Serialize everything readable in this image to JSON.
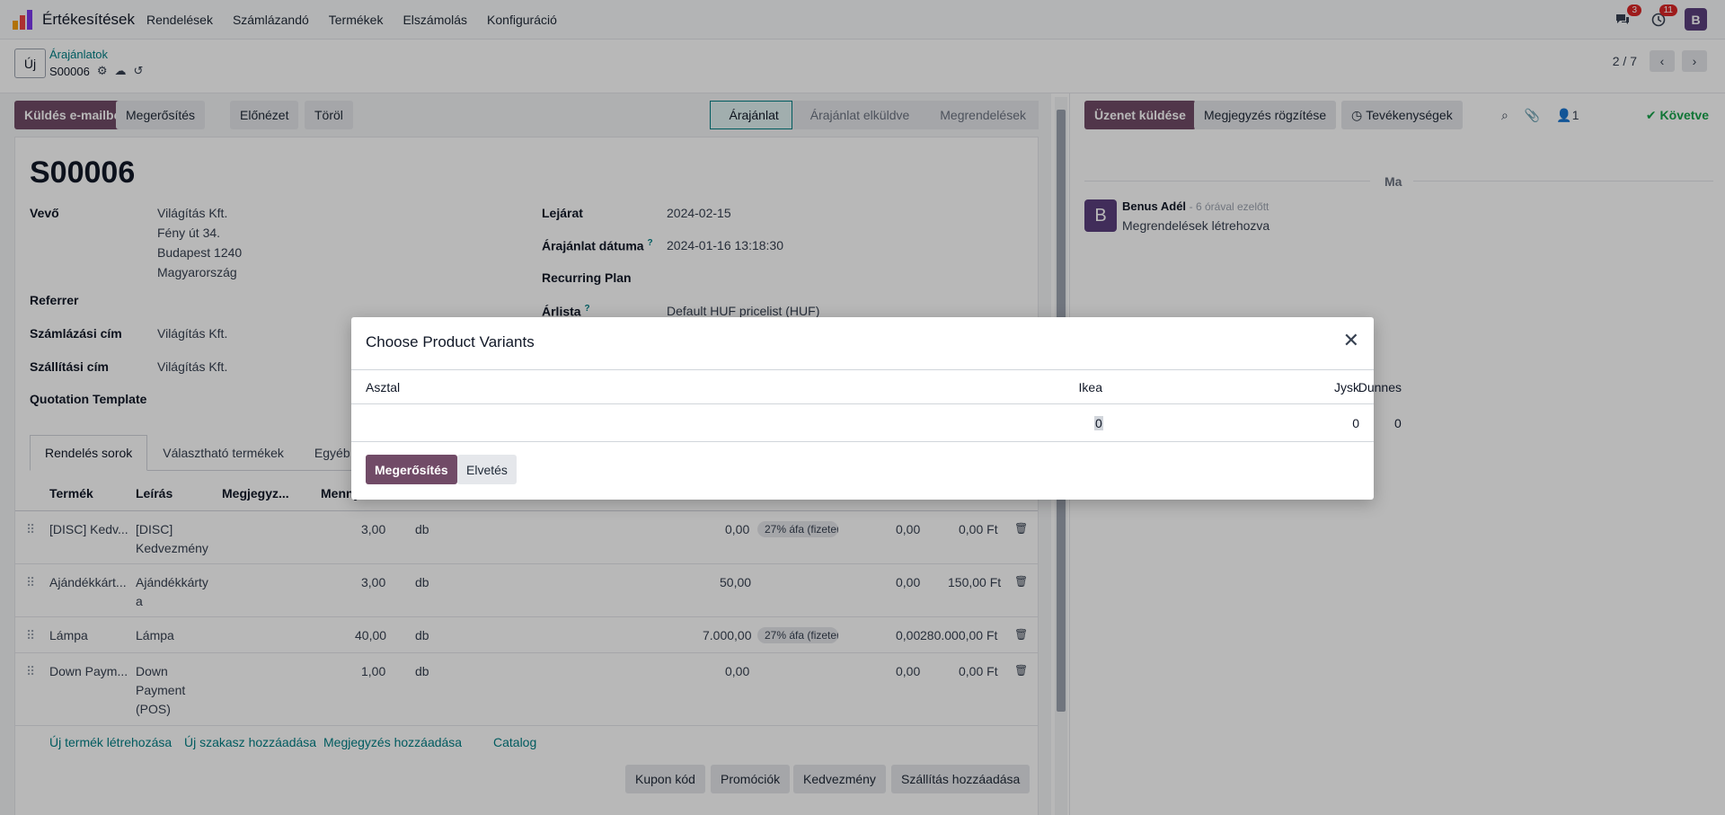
{
  "navbar": {
    "app_name": "Értékesítések",
    "menu": [
      "Rendelések",
      "Számlázandó",
      "Termékek",
      "Elszámolás",
      "Konfiguráció"
    ],
    "messages_badge": "3",
    "activities_badge": "11",
    "user_initial": "B"
  },
  "control": {
    "new_label": "Új",
    "breadcrumb": "Árajánlatok",
    "record": "S00006",
    "pager": "2 / 7"
  },
  "statusbar": {
    "buttons": [
      "Küldés e-mailben",
      "Megerősítés",
      "Előnézet",
      "Töröl"
    ],
    "stages": [
      "Árajánlat",
      "Árajánlat elküldve",
      "Megrendelések"
    ]
  },
  "form": {
    "title": "S00006",
    "customer_label": "Vevő",
    "customer_lines": [
      "Világítás Kft.",
      "Fény út 34.",
      "Budapest 1240",
      "Magyarország"
    ],
    "referrer_label": "Referrer",
    "invoice_address_label": "Számlázási cím",
    "invoice_address": "Világítás Kft.",
    "delivery_address_label": "Szállítási cím",
    "delivery_address": "Világítás Kft.",
    "template_label": "Quotation Template",
    "expiration_label": "Lejárat",
    "expiration": "2024-02-15",
    "quote_date_label": "Árajánlat dátuma",
    "quote_date": "2024-01-16 13:18:30",
    "recurring_label": "Recurring Plan",
    "pricelist_label": "Árlista",
    "pricelist": "Default HUF pricelist (HUF)",
    "tooltip_mark": "?"
  },
  "tabs": [
    "Rendelés sorok",
    "Választható termékek",
    "Egyéb információ"
  ],
  "table": {
    "headers": [
      "Termék",
      "Leírás",
      "Megjegyz...",
      "Menny"
    ],
    "rows": [
      {
        "product": "[DISC] Kedv...",
        "desc1": "[DISC]",
        "desc2": "Kedvezmény",
        "desc3": "",
        "qty": "3,00",
        "uom": "db",
        "price": "0,00",
        "tax": "27% áfa (fizetendő)",
        "disc": "0,00",
        "subtotal": "0,00 Ft"
      },
      {
        "product": "Ajándékkárt...",
        "desc1": "Ajándékkárty",
        "desc2": "a",
        "desc3": "",
        "qty": "3,00",
        "uom": "db",
        "price": "50,00",
        "tax": "",
        "disc": "0,00",
        "subtotal": "150,00 Ft"
      },
      {
        "product": "Lámpa",
        "desc1": "Lámpa",
        "desc2": "",
        "desc3": "",
        "qty": "40,00",
        "uom": "db",
        "price": "7.000,00",
        "tax": "27% áfa (fizetendő)",
        "disc": "0,00",
        "subtotal": "280.000,00 Ft"
      },
      {
        "product": "Down Paym...",
        "desc1": "Down",
        "desc2": "Payment",
        "desc3": "(POS)",
        "qty": "1,00",
        "uom": "db",
        "price": "0,00",
        "tax": "",
        "disc": "0,00",
        "subtotal": "0,00 Ft"
      }
    ]
  },
  "links": [
    "Új termék létrehozása",
    "Új szakasz hozzáadása",
    "Megjegyzés hozzáadása",
    "Catalog"
  ],
  "bottom_buttons": [
    "Kupon kód",
    "Promóciók",
    "Kedvezmény",
    "Szállítás hozzáadása"
  ],
  "chatter": {
    "send_message": "Üzenet küldése",
    "log_note": "Megjegyzés rögzítése",
    "activities": "Tevékenységek",
    "followers_count": "1",
    "follow_label": "Követve",
    "date_separator": "Ma",
    "author_initial": "B",
    "author": "Benus Adél",
    "time": "- 6 órával ezelőtt",
    "body": "Megrendelések létrehozva"
  },
  "modal": {
    "title": "Choose Product Variants",
    "headers": [
      "Asztal",
      "Ikea",
      "Dunnes",
      "Jysk"
    ],
    "values": [
      "0",
      "0",
      "0"
    ],
    "confirm": "Megerősítés",
    "discard": "Elvetés"
  }
}
